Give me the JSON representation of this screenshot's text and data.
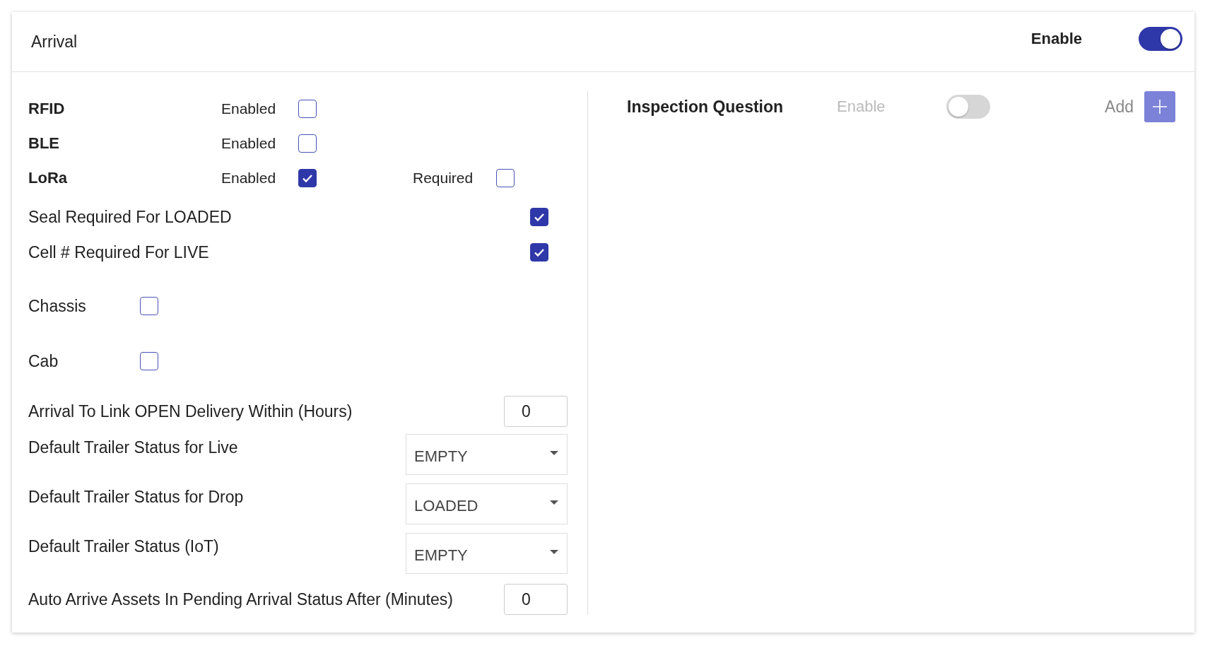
{
  "panel": {
    "title": "Arrival",
    "enable": {
      "label": "Enable",
      "on": true
    }
  },
  "tracking": [
    {
      "name": "RFID",
      "enabled_label": "Enabled",
      "enabled": false
    },
    {
      "name": "BLE",
      "enabled_label": "Enabled",
      "enabled": false
    },
    {
      "name": "LoRa",
      "enabled_label": "Enabled",
      "enabled": true,
      "required_label": "Required",
      "required": false
    }
  ],
  "requirements": [
    {
      "label": "Seal Required For LOADED",
      "checked": true
    },
    {
      "label": "Cell # Required For LIVE",
      "checked": true
    }
  ],
  "equipment": [
    {
      "label": "Chassis",
      "checked": false
    },
    {
      "label": "Cab",
      "checked": false
    }
  ],
  "fields": [
    {
      "kind": "number",
      "label": "Arrival To Link OPEN Delivery Within (Hours)",
      "value": "0"
    },
    {
      "kind": "select",
      "label": "Default Trailer Status for Live",
      "value": "EMPTY"
    },
    {
      "kind": "select",
      "label": "Default Trailer Status for Drop",
      "value": "LOADED"
    },
    {
      "kind": "select",
      "label": "Default Trailer Status (IoT)",
      "value": "EMPTY"
    },
    {
      "kind": "number",
      "label": "Auto Arrive Assets In Pending Arrival Status After (Minutes)",
      "value": "0"
    }
  ],
  "inspection": {
    "title": "Inspection Question",
    "enable": {
      "label": "Enable",
      "on": false
    },
    "add_label": "Add"
  }
}
